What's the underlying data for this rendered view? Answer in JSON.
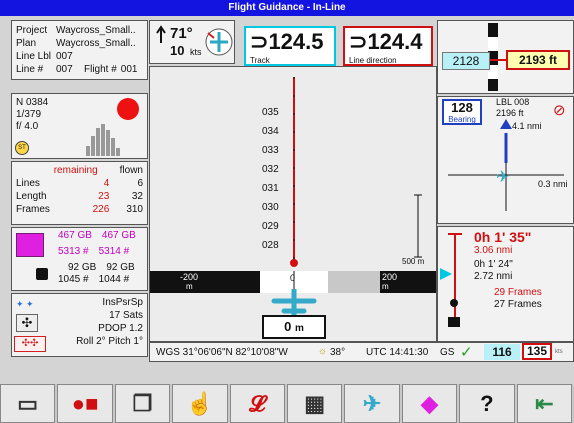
{
  "title": "Flight Guidance - In-Line",
  "project": {
    "project_label": "Project",
    "project_value": "Waycross_Small..",
    "plan_label": "Plan",
    "plan_value": "Waycross_Small..",
    "line_lbl_label": "Line Lbl",
    "line_lbl_value": "007",
    "line_label": "Line #",
    "line_value": "007",
    "flight_label": "Flight #",
    "flight_value": "001"
  },
  "camera": {
    "n": "N 0384",
    "frac": "1/379",
    "fstop": "f/ 4.0",
    "st": "ST"
  },
  "lines_table": {
    "col_remaining": "remaining",
    "col_flown": "flown",
    "rows": [
      {
        "label": "Lines",
        "remaining": "4",
        "flown": "6"
      },
      {
        "label": "Length",
        "remaining": "23",
        "flown": "32"
      },
      {
        "label": "Frames",
        "remaining": "226",
        "flown": "310"
      }
    ]
  },
  "storage": {
    "top_left": "467 GB",
    "top_right": "467 GB",
    "mid_left": "5313 #",
    "mid_right": "5314 #",
    "gb_left": "92 GB",
    "gb_right": "92 GB",
    "num_left": "1045 #",
    "num_right": "1044 #"
  },
  "gps": {
    "mode": "InsPsrSp",
    "sats": "17 Sats",
    "pdop": "PDOP 1.2",
    "attitude": "Roll 2° Pitch 1°"
  },
  "wind": {
    "dir": "71°",
    "speed": "10",
    "unit": "kts"
  },
  "track": {
    "value": "124.5",
    "label": "Track"
  },
  "line_direction": {
    "value": "124.4",
    "label": "Line direction"
  },
  "altitude": {
    "current": "2128",
    "target": "2193 ft"
  },
  "bearing": {
    "value": "128",
    "label": "Bearing",
    "lbl": "LBL 008",
    "dist_ft": "2196 ft",
    "nmi_up": "4.1 nmi",
    "nmi_right": "0.3 nmi"
  },
  "timing": {
    "time": "0h 1' 35\"",
    "dist1": "3.06 nmi",
    "time2": "0h 1' 24\"",
    "dist2": "2.72 nmi",
    "frames1": "29 Frames",
    "frames2": "27 Frames"
  },
  "map": {
    "scale_labels": [
      "035",
      "034",
      "033",
      "032",
      "031",
      "030",
      "029",
      "028"
    ],
    "scale_bar": "500 m",
    "xtrack_left": "-200",
    "xtrack_left_unit": "m",
    "xtrack_center": "0",
    "xtrack_right": "200",
    "xtrack_right_unit": "m",
    "offset_value": "0",
    "offset_unit": "m"
  },
  "status": {
    "coords": "WGS 31°06'06\"N 82°10'08\"W",
    "sun": "38°",
    "utc": "UTC 14:41:30",
    "gs_label": "GS",
    "gs_value": "116",
    "gs_target": "135",
    "gs_unit": "kts"
  },
  "colors": {
    "titlebar": "#1414e0",
    "accent_cyan": "#00c8e0",
    "accent_red": "#d01010",
    "magenta": "#c000c0",
    "track_box": "#b8f0f8",
    "target_box": "#ffffb0"
  },
  "toolbar": {
    "buttons": [
      "new-line-icon",
      "record-icon",
      "windows-icon",
      "touch-select-icon",
      "clip-icon",
      "map-layers-icon",
      "aircraft-profile-icon",
      "shapes-icon",
      "help-icon",
      "exit-icon"
    ]
  }
}
